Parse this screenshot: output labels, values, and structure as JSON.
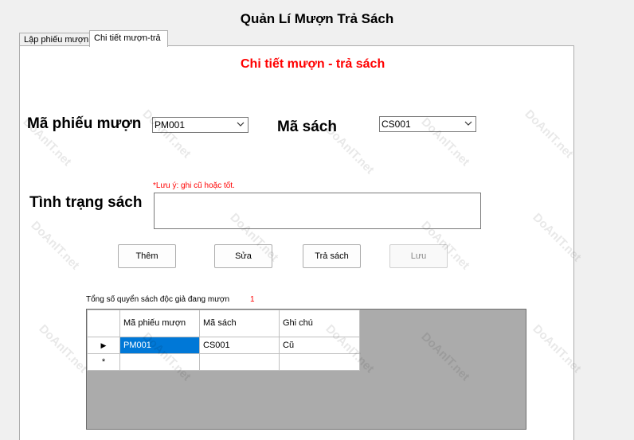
{
  "window": {
    "title": "Quản Lí Mượn Trả Sách"
  },
  "tabs": [
    {
      "label": "Lập phiếu mượn",
      "active": false
    },
    {
      "label": "Chi tiết mượn-trả",
      "active": true
    }
  ],
  "form": {
    "section_title": "Chi tiết mượn - trả  sách",
    "loan_id_label": "Mã phiếu mượn",
    "loan_id_value": "PM001",
    "book_id_label": "Mã sách",
    "book_id_value": "CS001",
    "condition_label": "Tình trạng sách",
    "condition_hint": "*Lưu ý: ghi cũ hoặc tốt.",
    "condition_value": ""
  },
  "buttons": {
    "add": "Thêm",
    "edit": "Sửa",
    "return": "Trả sách",
    "save": "Lưu"
  },
  "summary": {
    "label": "Tổng số quyển sách độc giả đang mượn",
    "value": "1"
  },
  "grid": {
    "columns": [
      "Mã phiếu mượn",
      "Mã sách",
      "Ghi chú"
    ],
    "rows": [
      {
        "loan_id": "PM001",
        "book_id": "CS001",
        "note": "Cũ"
      }
    ],
    "current_row_marker": "▶",
    "new_row_marker": "*"
  },
  "watermark": {
    "text": "DoAnIT.net"
  },
  "colors": {
    "accent_red": "#ff0000",
    "selection": "#0078d7"
  }
}
